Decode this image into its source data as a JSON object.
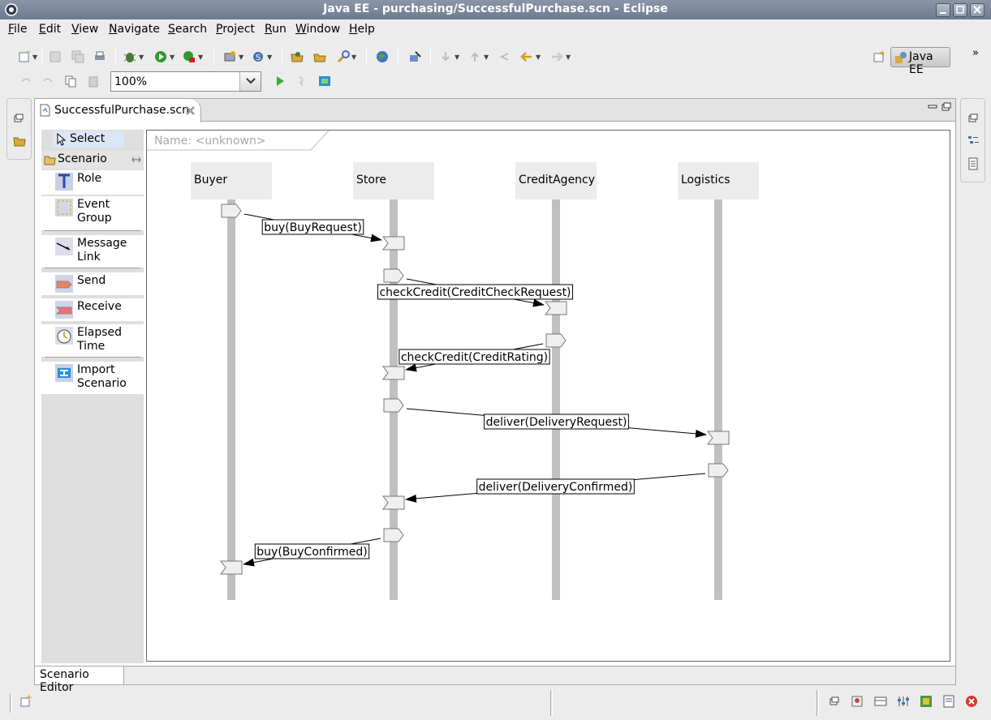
{
  "window": {
    "title": "Java EE - purchasing/SuccessfulPurchase.scn - Eclipse"
  },
  "menu": [
    {
      "label": "File",
      "key": "F",
      "rest": "ile"
    },
    {
      "label": "Edit",
      "key": "E",
      "rest": "dit"
    },
    {
      "label": "View",
      "key": "V",
      "rest": "iew"
    },
    {
      "label": "Navigate",
      "key": "N",
      "rest": "avigate"
    },
    {
      "label": "Search",
      "key": "S",
      "rest": "earch"
    },
    {
      "label": "Project",
      "key": "P",
      "rest": "roject"
    },
    {
      "label": "Run",
      "key": "R",
      "rest": "un"
    },
    {
      "label": "Window",
      "key": "W",
      "rest": "indow"
    },
    {
      "label": "Help",
      "key": "H",
      "rest": "elp"
    }
  ],
  "toolbar": {
    "zoom": "100%"
  },
  "perspective": {
    "label": "Java EE"
  },
  "editor": {
    "tab_label": "SuccessfulPurchase.scn",
    "bottom_tab": "Scenario Editor"
  },
  "palette": {
    "select": "Select",
    "drawer": "Scenario",
    "items": [
      {
        "label_1": "Role",
        "label_2": "",
        "icon": "role-icon"
      },
      {
        "label_1": "Event",
        "label_2": "Group",
        "icon": "event-group-icon"
      },
      {
        "label_1": "Message",
        "label_2": "Link",
        "icon": "message-link-icon"
      },
      {
        "label_1": "Send",
        "label_2": "",
        "icon": "send-icon"
      },
      {
        "label_1": "Receive",
        "label_2": "",
        "icon": "receive-icon"
      },
      {
        "label_1": "Elapsed",
        "label_2": "Time",
        "icon": "elapsed-time-icon"
      },
      {
        "label_1": "Import",
        "label_2": "Scenario",
        "icon": "import-scenario-icon"
      }
    ]
  },
  "scenario": {
    "name_prefix": "Name:",
    "name_value": "<unknown>",
    "roles": [
      "Buyer",
      "Store",
      "CreditAgency",
      "Logistics"
    ],
    "messages": [
      {
        "from": 0,
        "to": 1,
        "label": "buy(BuyRequest)"
      },
      {
        "from": 1,
        "to": 2,
        "label": "checkCredit(CreditCheckRequest)"
      },
      {
        "from": 2,
        "to": 1,
        "label": "checkCredit(CreditRating)"
      },
      {
        "from": 1,
        "to": 3,
        "label": "deliver(DeliveryRequest)"
      },
      {
        "from": 3,
        "to": 1,
        "label": "deliver(DeliveryConfirmed)"
      },
      {
        "from": 1,
        "to": 0,
        "label": "buy(BuyConfirmed)"
      }
    ]
  },
  "colors": {
    "title_bar": "#7a8699",
    "lifeline": "#c0c0c0",
    "role_box": "#ececec",
    "selection": "#dbe7f7"
  }
}
